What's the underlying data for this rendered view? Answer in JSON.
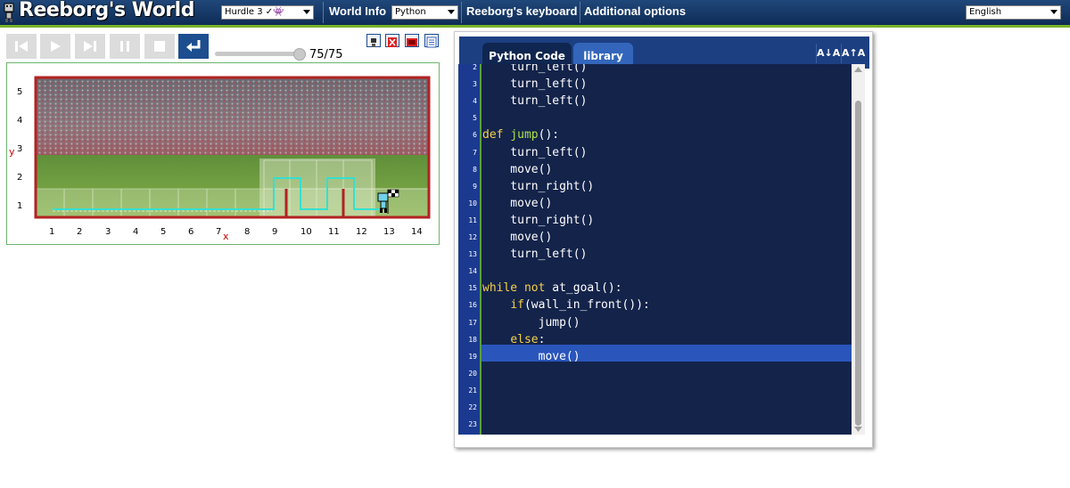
{
  "app": {
    "title": "Reeborg's World"
  },
  "toolbar": {
    "world_select": "Hurdle 3 ✓👾",
    "world_info": "World Info",
    "language_select": "Python",
    "keyboard": "Reeborg's keyboard",
    "additional_options": "Additional options",
    "ui_language_select": "English"
  },
  "controls": {
    "reverse_step": "reverse-step-icon",
    "run": "play-icon",
    "step": "step-icon",
    "pause": "pause-icon",
    "stop": "stop-icon",
    "reload": "reload-icon",
    "step_counter": "75/75",
    "slider_fraction": 1.0
  },
  "world": {
    "y_labels": [
      "5",
      "4",
      "3",
      "2",
      "1"
    ],
    "x_labels": [
      "1",
      "2",
      "3",
      "4",
      "5",
      "6",
      "7",
      "8",
      "9",
      "10",
      "11",
      "12",
      "13",
      "14"
    ],
    "y_axis_letter": "y",
    "x_axis_letter": "x",
    "wall_color": "#b22222",
    "trace_color": "#34e0d0"
  },
  "editor": {
    "tabs": [
      "Python Code",
      "library"
    ],
    "font_decrease": "A↓A",
    "font_increase": "A↑A",
    "highlighted_line": 19,
    "lines": [
      {
        "n": "2",
        "segs": [
          {
            "t": "    turn_left()",
            "c": ""
          }
        ]
      },
      {
        "n": "3",
        "segs": [
          {
            "t": "    turn_left()",
            "c": ""
          }
        ]
      },
      {
        "n": "4",
        "segs": [
          {
            "t": "    turn_left()",
            "c": ""
          }
        ]
      },
      {
        "n": "5",
        "segs": [
          {
            "t": "",
            "c": ""
          }
        ]
      },
      {
        "n": "6",
        "segs": [
          {
            "t": "def ",
            "c": "kw"
          },
          {
            "t": "jump",
            "c": "fn"
          },
          {
            "t": "():",
            "c": ""
          }
        ]
      },
      {
        "n": "7",
        "segs": [
          {
            "t": "    turn_left()",
            "c": ""
          }
        ]
      },
      {
        "n": "8",
        "segs": [
          {
            "t": "    move()",
            "c": ""
          }
        ]
      },
      {
        "n": "9",
        "segs": [
          {
            "t": "    turn_right()",
            "c": ""
          }
        ]
      },
      {
        "n": "10",
        "segs": [
          {
            "t": "    move()",
            "c": ""
          }
        ]
      },
      {
        "n": "11",
        "segs": [
          {
            "t": "    turn_right()",
            "c": ""
          }
        ]
      },
      {
        "n": "12",
        "segs": [
          {
            "t": "    move()",
            "c": ""
          }
        ]
      },
      {
        "n": "13",
        "segs": [
          {
            "t": "    turn_left()",
            "c": ""
          }
        ]
      },
      {
        "n": "14",
        "segs": [
          {
            "t": "",
            "c": ""
          }
        ]
      },
      {
        "n": "15",
        "segs": [
          {
            "t": "while ",
            "c": "kw"
          },
          {
            "t": "not ",
            "c": "kw"
          },
          {
            "t": "at_goal():",
            "c": ""
          }
        ]
      },
      {
        "n": "16",
        "segs": [
          {
            "t": "    ",
            "c": ""
          },
          {
            "t": "if",
            "c": "kw"
          },
          {
            "t": "(wall_in_front()):",
            "c": ""
          }
        ]
      },
      {
        "n": "17",
        "segs": [
          {
            "t": "        jump()",
            "c": ""
          }
        ]
      },
      {
        "n": "18",
        "segs": [
          {
            "t": "    ",
            "c": ""
          },
          {
            "t": "else",
            "c": "kw"
          },
          {
            "t": ":",
            "c": ""
          }
        ]
      },
      {
        "n": "19",
        "segs": [
          {
            "t": "        move()",
            "c": ""
          }
        ]
      },
      {
        "n": "20",
        "segs": [
          {
            "t": "",
            "c": ""
          }
        ]
      },
      {
        "n": "21",
        "segs": [
          {
            "t": "",
            "c": ""
          }
        ]
      },
      {
        "n": "22",
        "segs": [
          {
            "t": "",
            "c": ""
          }
        ]
      },
      {
        "n": "23",
        "segs": [
          {
            "t": "",
            "c": ""
          }
        ]
      }
    ]
  }
}
